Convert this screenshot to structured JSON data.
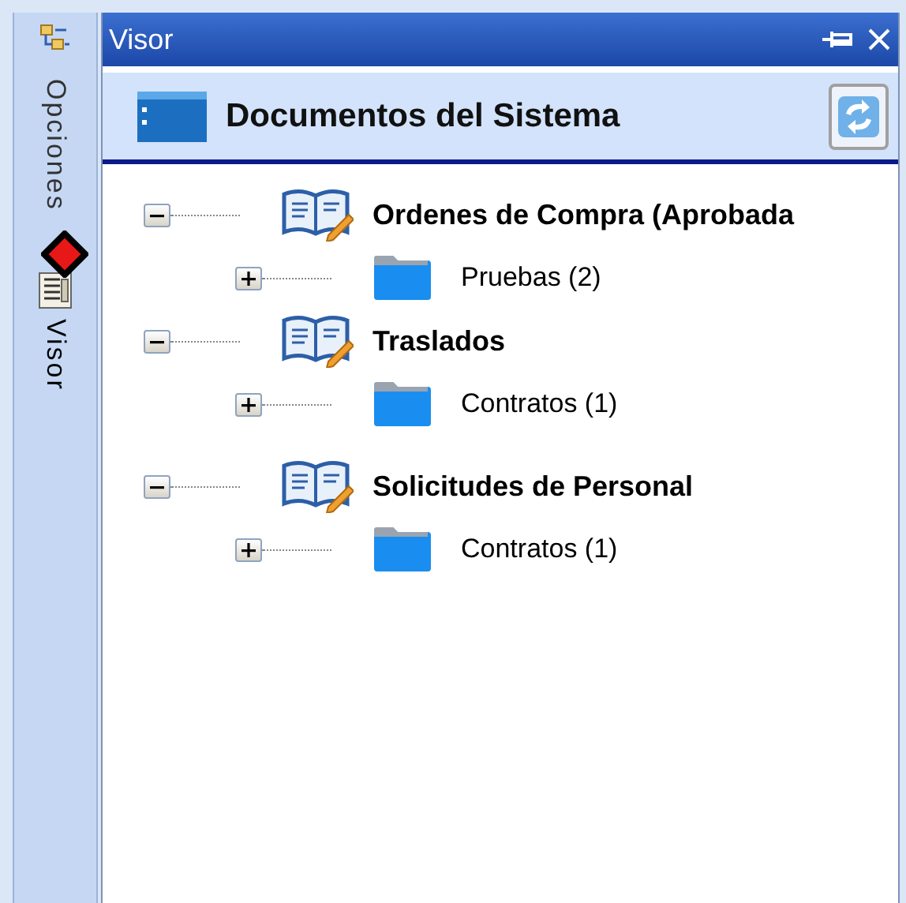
{
  "side_tabs": [
    {
      "label": "Opciones",
      "kind": "options",
      "selected": false
    },
    {
      "label": "Visor",
      "kind": "viewer",
      "selected": true
    }
  ],
  "panel": {
    "title": "Visor"
  },
  "header": {
    "title": "Documentos del Sistema"
  },
  "tree": [
    {
      "label": "Ordenes de Compra (Aprobada",
      "kind": "document",
      "expanded": true,
      "children": [
        {
          "label": "Pruebas (2)",
          "kind": "folder",
          "expanded": false
        }
      ]
    },
    {
      "label": "Traslados",
      "kind": "document",
      "expanded": true,
      "children": [
        {
          "label": "Contratos (1)",
          "kind": "folder",
          "expanded": false
        }
      ]
    },
    {
      "label": "Solicitudes de Personal",
      "kind": "document",
      "expanded": true,
      "children": [
        {
          "label": "Contratos (1)",
          "kind": "folder",
          "expanded": false
        }
      ]
    }
  ]
}
